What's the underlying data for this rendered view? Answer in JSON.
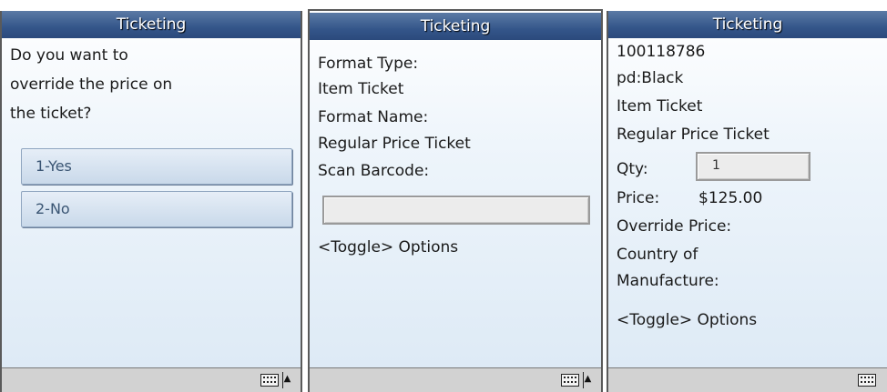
{
  "screen1": {
    "title": "Ticketing",
    "question_lines": [
      "Do you want to",
      "override the price on",
      "the ticket?"
    ],
    "options": [
      "1-Yes",
      "2-No"
    ]
  },
  "screen2": {
    "title": "Ticketing",
    "format_type_label": "Format Type:",
    "format_type_value": "Item Ticket",
    "format_name_label": "Format Name:",
    "format_name_value": "Regular Price Ticket",
    "scan_barcode_label": "Scan Barcode:",
    "barcode_value": "",
    "toggle_options": "<Toggle> Options"
  },
  "screen3": {
    "title": "Ticketing",
    "item_number": "100118786",
    "description": "pd:Black",
    "format_type": "Item Ticket",
    "format_name": "Regular Price Ticket",
    "qty_label": "Qty:",
    "qty_value": "1",
    "price_label": "Price:",
    "price_value": "$125.00",
    "override_price_label": "Override Price:",
    "country_label_line1": "Country of",
    "country_label_line2": "Manufacture:",
    "toggle_options": "<Toggle> Options"
  },
  "icons": {
    "keyboard": "keyboard-icon",
    "up_arrow": "up-arrow-icon"
  }
}
